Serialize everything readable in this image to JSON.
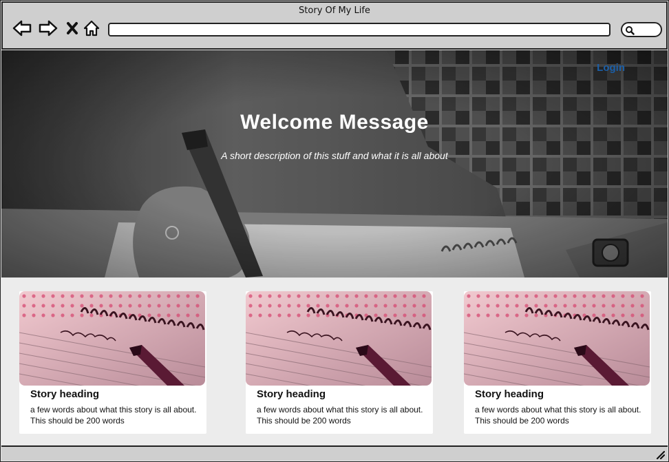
{
  "window": {
    "title": "Story Of My Life"
  },
  "toolbar": {
    "icons": [
      "back-arrow-icon",
      "forward-arrow-icon",
      "close-x-icon",
      "home-icon"
    ],
    "address_value": "",
    "search_icon": "search-icon"
  },
  "hero": {
    "login_label": "Login",
    "title": "Welcome Message",
    "description": "A short description of this stuff and what it is all about"
  },
  "cards": [
    {
      "heading": "Story heading",
      "text": "a few words about what this story is all about. This should be 200 words"
    },
    {
      "heading": "Story heading",
      "text": "a few words about what this story is all about. This should be 200 words"
    },
    {
      "heading": "Story heading",
      "text": "a few words about what this story is all about. This should be 200 words"
    }
  ],
  "colors": {
    "chrome": "#cfcfcf",
    "login_link": "#1b5fa8",
    "content_bg": "#ececec"
  }
}
